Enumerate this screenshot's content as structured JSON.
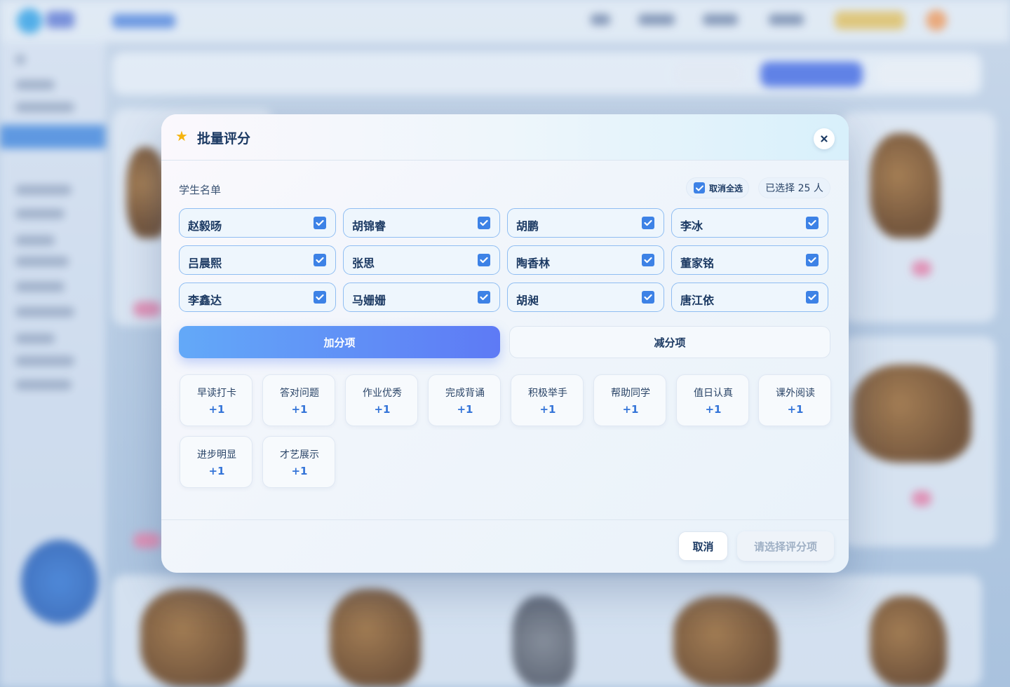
{
  "dialog": {
    "title": "批量评分",
    "close_label": "×"
  },
  "students_section": {
    "label": "学生名单",
    "toggle_all_label": "取消全选",
    "toggle_all_checked": true,
    "selected_count_text": "已选择 25 人",
    "students": [
      {
        "name": "赵毅旸",
        "checked": true
      },
      {
        "name": "胡锦睿",
        "checked": true
      },
      {
        "name": "胡鹏",
        "checked": true
      },
      {
        "name": "李冰",
        "checked": true
      },
      {
        "name": "吕晨熙",
        "checked": true
      },
      {
        "name": "张思",
        "checked": true
      },
      {
        "name": "陶香林",
        "checked": true
      },
      {
        "name": "董家铭",
        "checked": true
      },
      {
        "name": "李鑫达",
        "checked": true
      },
      {
        "name": "马姗姗",
        "checked": true
      },
      {
        "name": "胡昶",
        "checked": true
      },
      {
        "name": "唐江依",
        "checked": true
      }
    ]
  },
  "tabs": {
    "add_label": "加分项",
    "minus_label": "减分项",
    "active": "add"
  },
  "score_items": [
    {
      "name": "早读打卡",
      "points": "+1"
    },
    {
      "name": "答对问题",
      "points": "+1"
    },
    {
      "name": "作业优秀",
      "points": "+1"
    },
    {
      "name": "完成背诵",
      "points": "+1"
    },
    {
      "name": "积极举手",
      "points": "+1"
    },
    {
      "name": "帮助同学",
      "points": "+1"
    },
    {
      "name": "值日认真",
      "points": "+1"
    },
    {
      "name": "课外阅读",
      "points": "+1"
    },
    {
      "name": "进步明显",
      "points": "+1"
    },
    {
      "name": "才艺展示",
      "points": "+1"
    }
  ],
  "footer": {
    "cancel_label": "取消",
    "submit_label": "请选择评分项"
  },
  "colors": {
    "accent": "#3d82e6",
    "points": "#3474d8",
    "star": "#f5b40f"
  }
}
